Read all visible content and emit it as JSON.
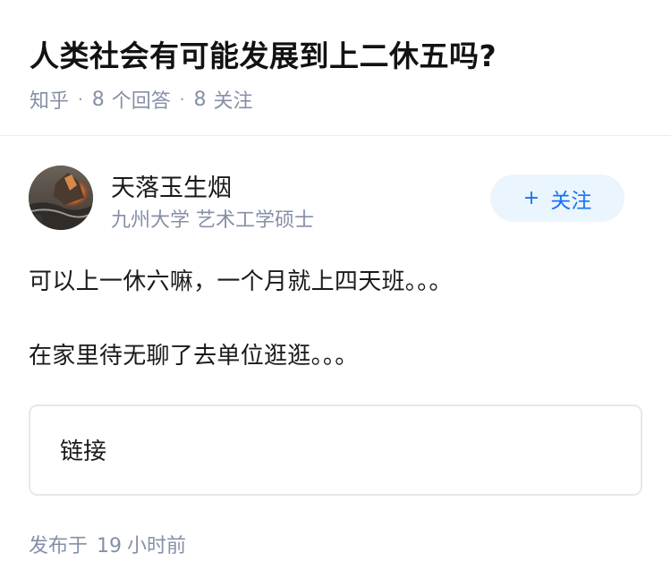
{
  "question": {
    "title": "人类社会有可能发展到上二休五吗?",
    "source": "知乎",
    "separator": "·",
    "answer_count": "8",
    "answer_label": "个回答",
    "follow_count": "8",
    "follow_label": "关注"
  },
  "answer": {
    "author": {
      "name": "天落玉生烟",
      "bio": "九州大学 艺术工学硕士",
      "avatar_icon": "avatar-image"
    },
    "follow_button": {
      "plus": "+",
      "label": "关注"
    },
    "paragraphs": [
      "可以上一休六嘛，一个月就上四天班。。。",
      "在家里待无聊了去单位逛逛。。。"
    ],
    "link_card": {
      "label": "链接"
    },
    "publish": {
      "prefix": "发布于",
      "value": "19",
      "unit": "小时前"
    }
  },
  "colors": {
    "meta_gray": "#8590a6",
    "accent_blue": "#1772f6",
    "button_bg": "#ebf5fd"
  }
}
